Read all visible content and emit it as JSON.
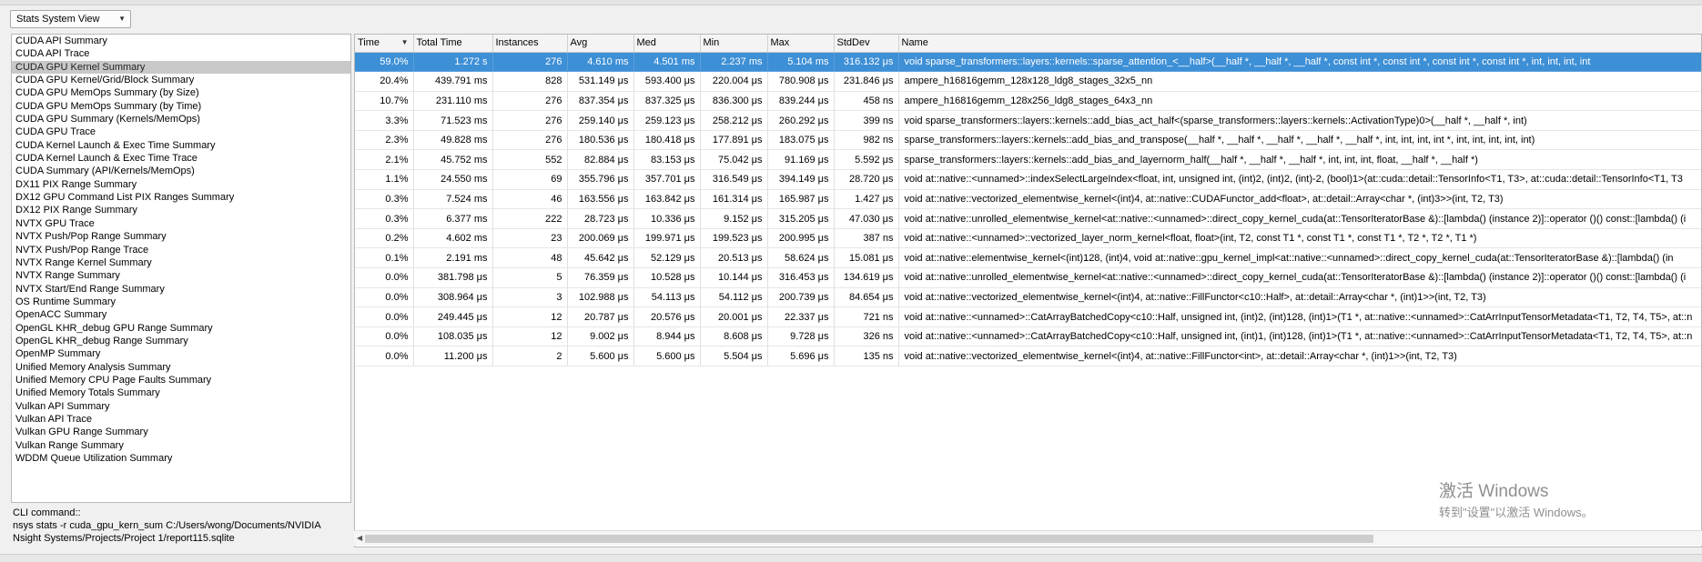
{
  "view_selector": {
    "label": "Stats System View"
  },
  "reports": [
    "CUDA API Summary",
    "CUDA API Trace",
    "CUDA GPU Kernel Summary",
    "CUDA GPU Kernel/Grid/Block Summary",
    "CUDA GPU MemOps Summary (by Size)",
    "CUDA GPU MemOps Summary (by Time)",
    "CUDA GPU Summary (Kernels/MemOps)",
    "CUDA GPU Trace",
    "CUDA Kernel Launch & Exec Time Summary",
    "CUDA Kernel Launch & Exec Time Trace",
    "CUDA Summary (API/Kernels/MemOps)",
    "DX11 PIX Range Summary",
    "DX12 GPU Command List PIX Ranges Summary",
    "DX12 PIX Range Summary",
    "NVTX GPU Trace",
    "NVTX Push/Pop Range Summary",
    "NVTX Push/Pop Range Trace",
    "NVTX Range Kernel Summary",
    "NVTX Range Summary",
    "NVTX Start/End Range Summary",
    "OS Runtime Summary",
    "OpenACC Summary",
    "OpenGL KHR_debug GPU Range Summary",
    "OpenGL KHR_debug Range Summary",
    "OpenMP Summary",
    "Unified Memory Analysis Summary",
    "Unified Memory CPU Page Faults Summary",
    "Unified Memory Totals Summary",
    "Vulkan API Summary",
    "Vulkan API Trace",
    "Vulkan GPU Range Summary",
    "Vulkan Range Summary",
    "WDDM Queue Utilization Summary"
  ],
  "selected_report_index": 2,
  "cli": {
    "label": "CLI command::",
    "line1": "nsys stats -r cuda_gpu_kern_sum C:/Users/wong/Documents/NVIDIA",
    "line2": "Nsight Systems/Projects/Project 1/report115.sqlite"
  },
  "table": {
    "columns": [
      "Time",
      "Total Time",
      "Instances",
      "Avg",
      "Med",
      "Min",
      "Max",
      "StdDev",
      "Name"
    ],
    "rows": [
      [
        "59.0%",
        "1.272 s",
        "276",
        "4.610 ms",
        "4.501 ms",
        "2.237 ms",
        "5.104 ms",
        "316.132 μs",
        "void sparse_transformers::layers::kernels::sparse_attention_<__half>(__half *, __half *, __half *, const int *, const int *, const int *, const int *, int, int, int, int"
      ],
      [
        "20.4%",
        "439.791 ms",
        "828",
        "531.149 μs",
        "593.400 μs",
        "220.004 μs",
        "780.908 μs",
        "231.846 μs",
        "ampere_h16816gemm_128x128_ldg8_stages_32x5_nn"
      ],
      [
        "10.7%",
        "231.110 ms",
        "276",
        "837.354 μs",
        "837.325 μs",
        "836.300 μs",
        "839.244 μs",
        "458 ns",
        "ampere_h16816gemm_128x256_ldg8_stages_64x3_nn"
      ],
      [
        "3.3%",
        "71.523 ms",
        "276",
        "259.140 μs",
        "259.123 μs",
        "258.212 μs",
        "260.292 μs",
        "399 ns",
        "void sparse_transformers::layers::kernels::add_bias_act_half<(sparse_transformers::layers::kernels::ActivationType)0>(__half *, __half *, int)"
      ],
      [
        "2.3%",
        "49.828 ms",
        "276",
        "180.536 μs",
        "180.418 μs",
        "177.891 μs",
        "183.075 μs",
        "982 ns",
        "sparse_transformers::layers::kernels::add_bias_and_transpose(__half *, __half *, __half *, __half *, __half *, int, int, int, int *, int, int, int, int, int)"
      ],
      [
        "2.1%",
        "45.752 ms",
        "552",
        "82.884 μs",
        "83.153 μs",
        "75.042 μs",
        "91.169 μs",
        "5.592 μs",
        "sparse_transformers::layers::kernels::add_bias_and_layernorm_half(__half *, __half *, __half *, int, int, int, float, __half *, __half *)"
      ],
      [
        "1.1%",
        "24.550 ms",
        "69",
        "355.796 μs",
        "357.701 μs",
        "316.549 μs",
        "394.149 μs",
        "28.720 μs",
        "void at::native::<unnamed>::indexSelectLargeIndex<float, int, unsigned int, (int)2, (int)2, (int)-2, (bool)1>(at::cuda::detail::TensorInfo<T1, T3>, at::cuda::detail::TensorInfo<T1, T3"
      ],
      [
        "0.3%",
        "7.524 ms",
        "46",
        "163.556 μs",
        "163.842 μs",
        "161.314 μs",
        "165.987 μs",
        "1.427 μs",
        "void at::native::vectorized_elementwise_kernel<(int)4, at::native::CUDAFunctor_add<float>, at::detail::Array<char *, (int)3>>(int, T2, T3)"
      ],
      [
        "0.3%",
        "6.377 ms",
        "222",
        "28.723 μs",
        "10.336 μs",
        "9.152 μs",
        "315.205 μs",
        "47.030 μs",
        "void at::native::unrolled_elementwise_kernel<at::native::<unnamed>::direct_copy_kernel_cuda(at::TensorIteratorBase &)::[lambda() (instance 2)]::operator ()() const::[lambda() (i"
      ],
      [
        "0.2%",
        "4.602 ms",
        "23",
        "200.069 μs",
        "199.971 μs",
        "199.523 μs",
        "200.995 μs",
        "387 ns",
        "void at::native::<unnamed>::vectorized_layer_norm_kernel<float, float>(int, T2, const T1 *, const T1 *, const T1 *, T2 *, T2 *, T1 *)"
      ],
      [
        "0.1%",
        "2.191 ms",
        "48",
        "45.642 μs",
        "52.129 μs",
        "20.513 μs",
        "58.624 μs",
        "15.081 μs",
        "void at::native::elementwise_kernel<(int)128, (int)4, void at::native::gpu_kernel_impl<at::native::<unnamed>::direct_copy_kernel_cuda(at::TensorIteratorBase &)::[lambda() (in"
      ],
      [
        "0.0%",
        "381.798 μs",
        "5",
        "76.359 μs",
        "10.528 μs",
        "10.144 μs",
        "316.453 μs",
        "134.619 μs",
        "void at::native::unrolled_elementwise_kernel<at::native::<unnamed>::direct_copy_kernel_cuda(at::TensorIteratorBase &)::[lambda() (instance 2)]::operator ()() const::[lambda() (i"
      ],
      [
        "0.0%",
        "308.964 μs",
        "3",
        "102.988 μs",
        "54.113 μs",
        "54.112 μs",
        "200.739 μs",
        "84.654 μs",
        "void at::native::vectorized_elementwise_kernel<(int)4, at::native::FillFunctor<c10::Half>, at::detail::Array<char *, (int)1>>(int, T2, T3)"
      ],
      [
        "0.0%",
        "249.445 μs",
        "12",
        "20.787 μs",
        "20.576 μs",
        "20.001 μs",
        "22.337 μs",
        "721 ns",
        "void at::native::<unnamed>::CatArrayBatchedCopy<c10::Half, unsigned int, (int)2, (int)128, (int)1>(T1 *, at::native::<unnamed>::CatArrInputTensorMetadata<T1, T2, T4, T5>, at::n"
      ],
      [
        "0.0%",
        "108.035 μs",
        "12",
        "9.002 μs",
        "8.944 μs",
        "8.608 μs",
        "9.728 μs",
        "326 ns",
        "void at::native::<unnamed>::CatArrayBatchedCopy<c10::Half, unsigned int, (int)1, (int)128, (int)1>(T1 *, at::native::<unnamed>::CatArrInputTensorMetadata<T1, T2, T4, T5>, at::n"
      ],
      [
        "0.0%",
        "11.200 μs",
        "2",
        "5.600 μs",
        "5.600 μs",
        "5.504 μs",
        "5.696 μs",
        "135 ns",
        "void at::native::vectorized_elementwise_kernel<(int)4, at::native::FillFunctor<int>, at::detail::Array<char *, (int)1>>(int, T2, T3)"
      ]
    ],
    "selected_row_index": 0,
    "sort_column": "Time"
  },
  "watermark": {
    "line1": "激活 Windows",
    "line2": "转到\"设置\"以激活 Windows。"
  },
  "colors": {
    "selection": "#3d8fd6",
    "report_selection": "#c8c8c8"
  }
}
